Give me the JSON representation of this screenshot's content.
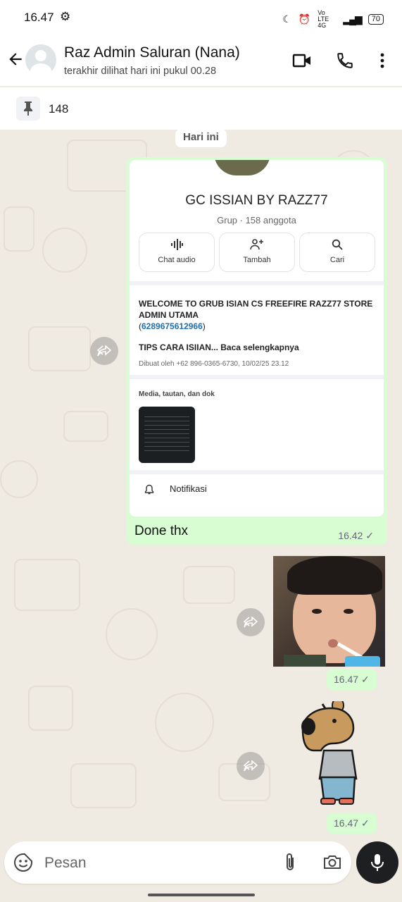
{
  "status_bar": {
    "time": "16.47",
    "network": "Vo LTE 4G",
    "battery": "70"
  },
  "header": {
    "title": "Raz Admin Saluran (Nana)",
    "subtitle": "terakhir dilihat hari ini pukul 00.28",
    "icons": [
      "back-arrow-icon",
      "video-call-icon",
      "phone-icon",
      "more-vert-icon"
    ]
  },
  "pinned": {
    "count": "148"
  },
  "chat": {
    "date_label": "Hari ini",
    "messages": [
      {
        "type": "group-card",
        "group_name": "GC ISSIAN BY RAZZ77",
        "group_meta": "Grup · 158 anggota",
        "actions": [
          {
            "label": "Chat audio",
            "icon": "audio-wave-icon"
          },
          {
            "label": "Tambah",
            "icon": "add-person-icon"
          },
          {
            "label": "Cari",
            "icon": "search-icon"
          }
        ],
        "description_line": "WELCOME TO GRUB ISIAN CS FREEFIRE RAZZ77 STORE ADMIN UTAMA",
        "description_link": "6289675612966",
        "description_tips": "TIPS CARA ISIIAN...",
        "read_more": "Baca selengkapnya",
        "created_by": "Dibuat oleh +62 896-0365-6730, 10/02/25 23.12",
        "media_title": "Media, tautan, dan dok",
        "notification_label": "Notifikasi",
        "text": "Done thx",
        "time": "16.42"
      },
      {
        "type": "image",
        "time": "16.47"
      },
      {
        "type": "sticker",
        "time": "16.47"
      }
    ]
  },
  "composer": {
    "placeholder": "Pesan"
  },
  "colors": {
    "outgoing_bubble": "#d9fdd3",
    "chat_background": "#efeae2",
    "link": "#1f6fb0",
    "tick": "#667781"
  }
}
